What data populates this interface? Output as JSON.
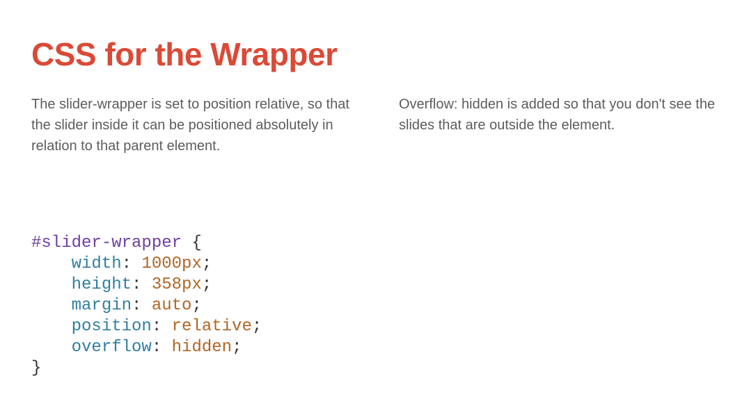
{
  "title": "CSS for the Wrapper",
  "paragraphs": {
    "left": "The slider-wrapper is set to position relative, so that the slider inside it can be positioned absolutely in relation to that parent element.",
    "right": "Overflow: hidden is added so that you don't see the slides that are outside the element."
  },
  "code": {
    "selector": "#slider-wrapper",
    "open_brace": "{",
    "close_brace": "}",
    "indent": "    ",
    "declarations": [
      {
        "property": "width",
        "value": "1000px",
        "value_class": "num"
      },
      {
        "property": "height",
        "value": "358px",
        "value_class": "num"
      },
      {
        "property": "margin",
        "value": "auto",
        "value_class": "kw"
      },
      {
        "property": "position",
        "value": "relative",
        "value_class": "kw"
      },
      {
        "property": "overflow",
        "value": "hidden",
        "value_class": "kw"
      }
    ]
  }
}
